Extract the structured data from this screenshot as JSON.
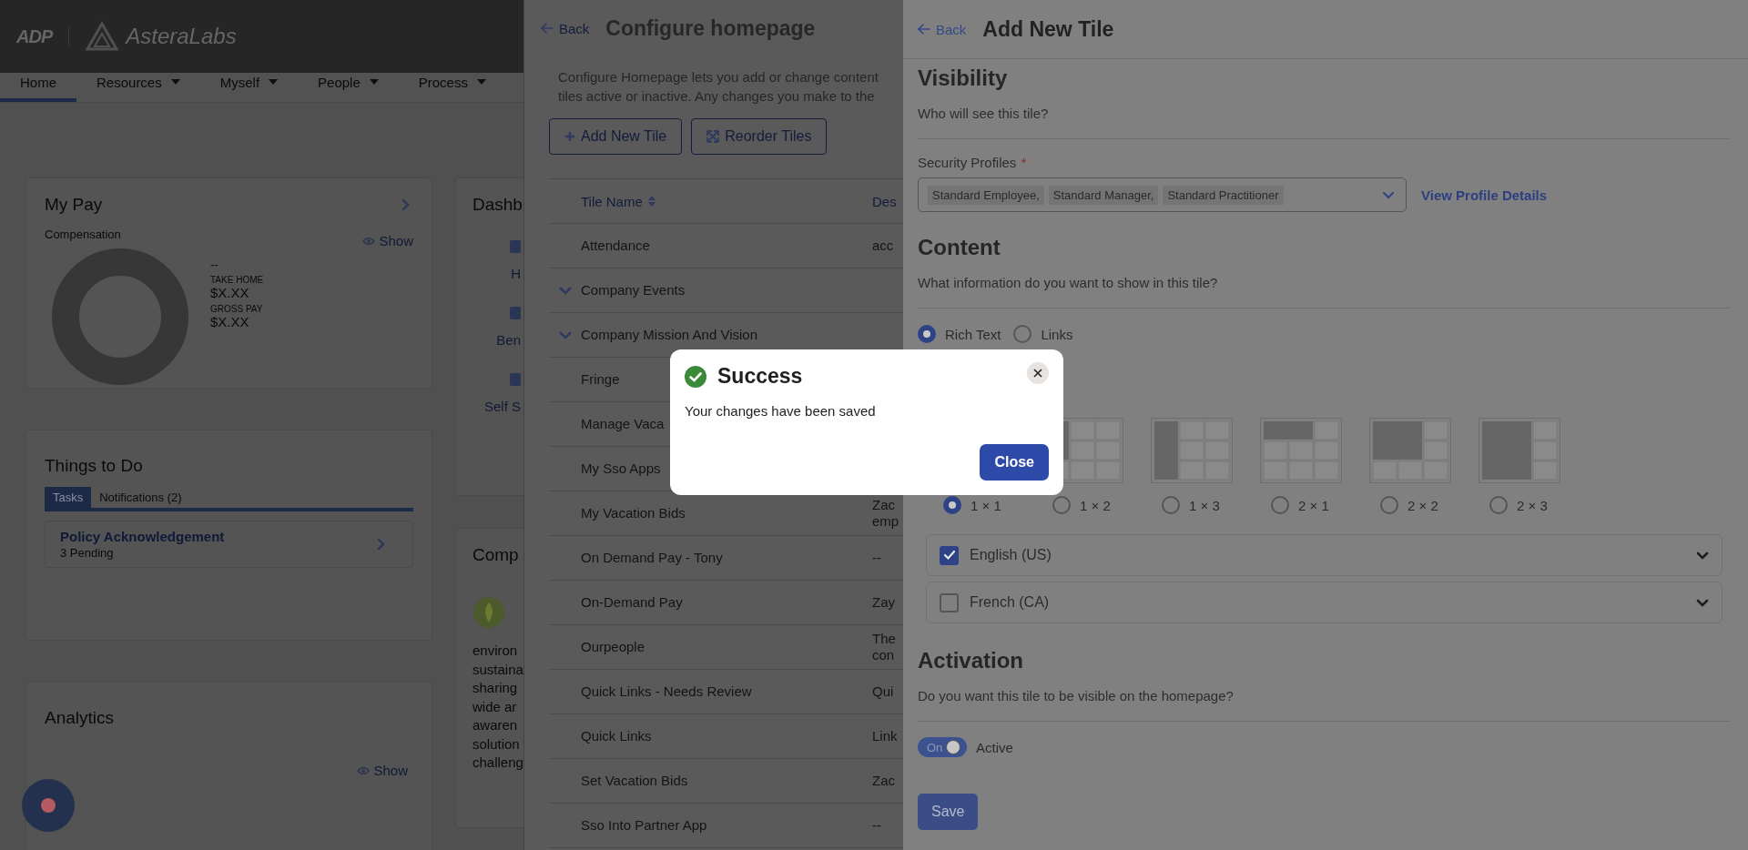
{
  "header": {
    "logo_text": "ADP",
    "brand": "AsteraLabs"
  },
  "nav": [
    {
      "label": "Home",
      "selected": true,
      "dropdown": false
    },
    {
      "label": "Resources",
      "selected": false,
      "dropdown": true
    },
    {
      "label": "Myself",
      "selected": false,
      "dropdown": true
    },
    {
      "label": "People",
      "selected": false,
      "dropdown": true
    },
    {
      "label": "Process",
      "selected": false,
      "dropdown": true
    }
  ],
  "my_pay": {
    "title": "My Pay",
    "subtitle": "Compensation",
    "show": "Show",
    "dash": "--",
    "take_home_label": "TAKE HOME",
    "take_home": "$X.XX",
    "gross_label": "GROSS PAY",
    "gross": "$X.XX"
  },
  "things_to_do": {
    "title": "Things to Do",
    "tabs": [
      {
        "label": "Tasks",
        "selected": true
      },
      {
        "label": "Notifications (2)",
        "selected": false
      }
    ],
    "tasks": [
      {
        "title": "Policy Acknowledgement",
        "detail": "3 Pending"
      }
    ]
  },
  "analytics": {
    "title": "Analytics",
    "show": "Show"
  },
  "dashboard_card": {
    "title": "Dashb",
    "items": [
      "H",
      "Ben",
      "Self S"
    ]
  },
  "company_card": {
    "title": "Comp",
    "lines": [
      "environ",
      "sustaina",
      "sharing",
      "wide ar",
      "awaren",
      "solution",
      "challeng"
    ]
  },
  "configure": {
    "back": "Back",
    "title": "Configure homepage",
    "description_lines": [
      "Configure Homepage lets you add or change content",
      "tiles active or inactive. Any changes you make to the"
    ],
    "buttons": [
      {
        "label": "Add New Tile",
        "kind": "add"
      },
      {
        "label": "Reorder Tiles",
        "kind": "reorder"
      }
    ],
    "table": {
      "columns": [
        {
          "label": "Tile Name",
          "sortable": true
        },
        {
          "label": "Des",
          "sortable": false
        }
      ],
      "rows": [
        {
          "name": "Attendance",
          "description": [
            "acc"
          ],
          "expandable": false
        },
        {
          "name": "Company Events",
          "description": [],
          "expandable": true
        },
        {
          "name": "Company Mission And Vision",
          "description": [],
          "expandable": true
        },
        {
          "name": "Fringe",
          "description": [],
          "expandable": false
        },
        {
          "name": "Manage Vaca",
          "description": [],
          "expandable": false
        },
        {
          "name": "My Sso Apps",
          "description": [],
          "expandable": false
        },
        {
          "name": "My Vacation Bids",
          "description": [
            "Zac",
            "emp"
          ],
          "expandable": false
        },
        {
          "name": "On Demand Pay - Tony",
          "description": [
            "--"
          ],
          "expandable": false
        },
        {
          "name": "On-Demand Pay",
          "description": [
            "Zay"
          ],
          "expandable": false
        },
        {
          "name": "Ourpeople",
          "description": [
            "The",
            "con"
          ],
          "expandable": false
        },
        {
          "name": "Quick Links - Needs Review",
          "description": [
            "Qui"
          ],
          "expandable": false
        },
        {
          "name": "Quick Links",
          "description": [
            "Link"
          ],
          "expandable": false
        },
        {
          "name": "Set Vacation Bids",
          "description": [
            "Zac"
          ],
          "expandable": false
        },
        {
          "name": "Sso Into Partner App",
          "description": [
            "--"
          ],
          "expandable": false
        }
      ]
    }
  },
  "add_tile": {
    "back": "Back",
    "title": "Add New Tile",
    "visibility": {
      "heading": "Visibility",
      "question": "Who will see this tile?",
      "field_label": "Security Profiles",
      "required_mark": "*",
      "profiles": [
        "Standard Employee,",
        "Standard Manager,",
        "Standard Practitioner"
      ],
      "link": "View Profile Details"
    },
    "content": {
      "heading": "Content",
      "question": "What information do you want to show in this tile?",
      "types": [
        {
          "label": "Rich Text",
          "selected": true
        },
        {
          "label": "Links",
          "selected": false
        }
      ],
      "layouts": [
        {
          "label": "1 × 1",
          "selected": true
        },
        {
          "label": "1 × 2",
          "selected": false
        },
        {
          "label": "1 × 3",
          "selected": false
        },
        {
          "label": "2 × 1",
          "selected": false
        },
        {
          "label": "2 × 2",
          "selected": false
        },
        {
          "label": "2 × 3",
          "selected": false
        }
      ],
      "languages": [
        {
          "label": "English (US)",
          "checked": true
        },
        {
          "label": "French (CA)",
          "checked": false
        }
      ]
    },
    "activation": {
      "heading": "Activation",
      "question": "Do you want this tile to be visible on the homepage?",
      "toggle": {
        "on": true,
        "label": "On"
      },
      "status": "Active"
    },
    "save": "Save"
  },
  "modal": {
    "title": "Success",
    "message": "Your changes have been saved",
    "close_label": "Close"
  }
}
